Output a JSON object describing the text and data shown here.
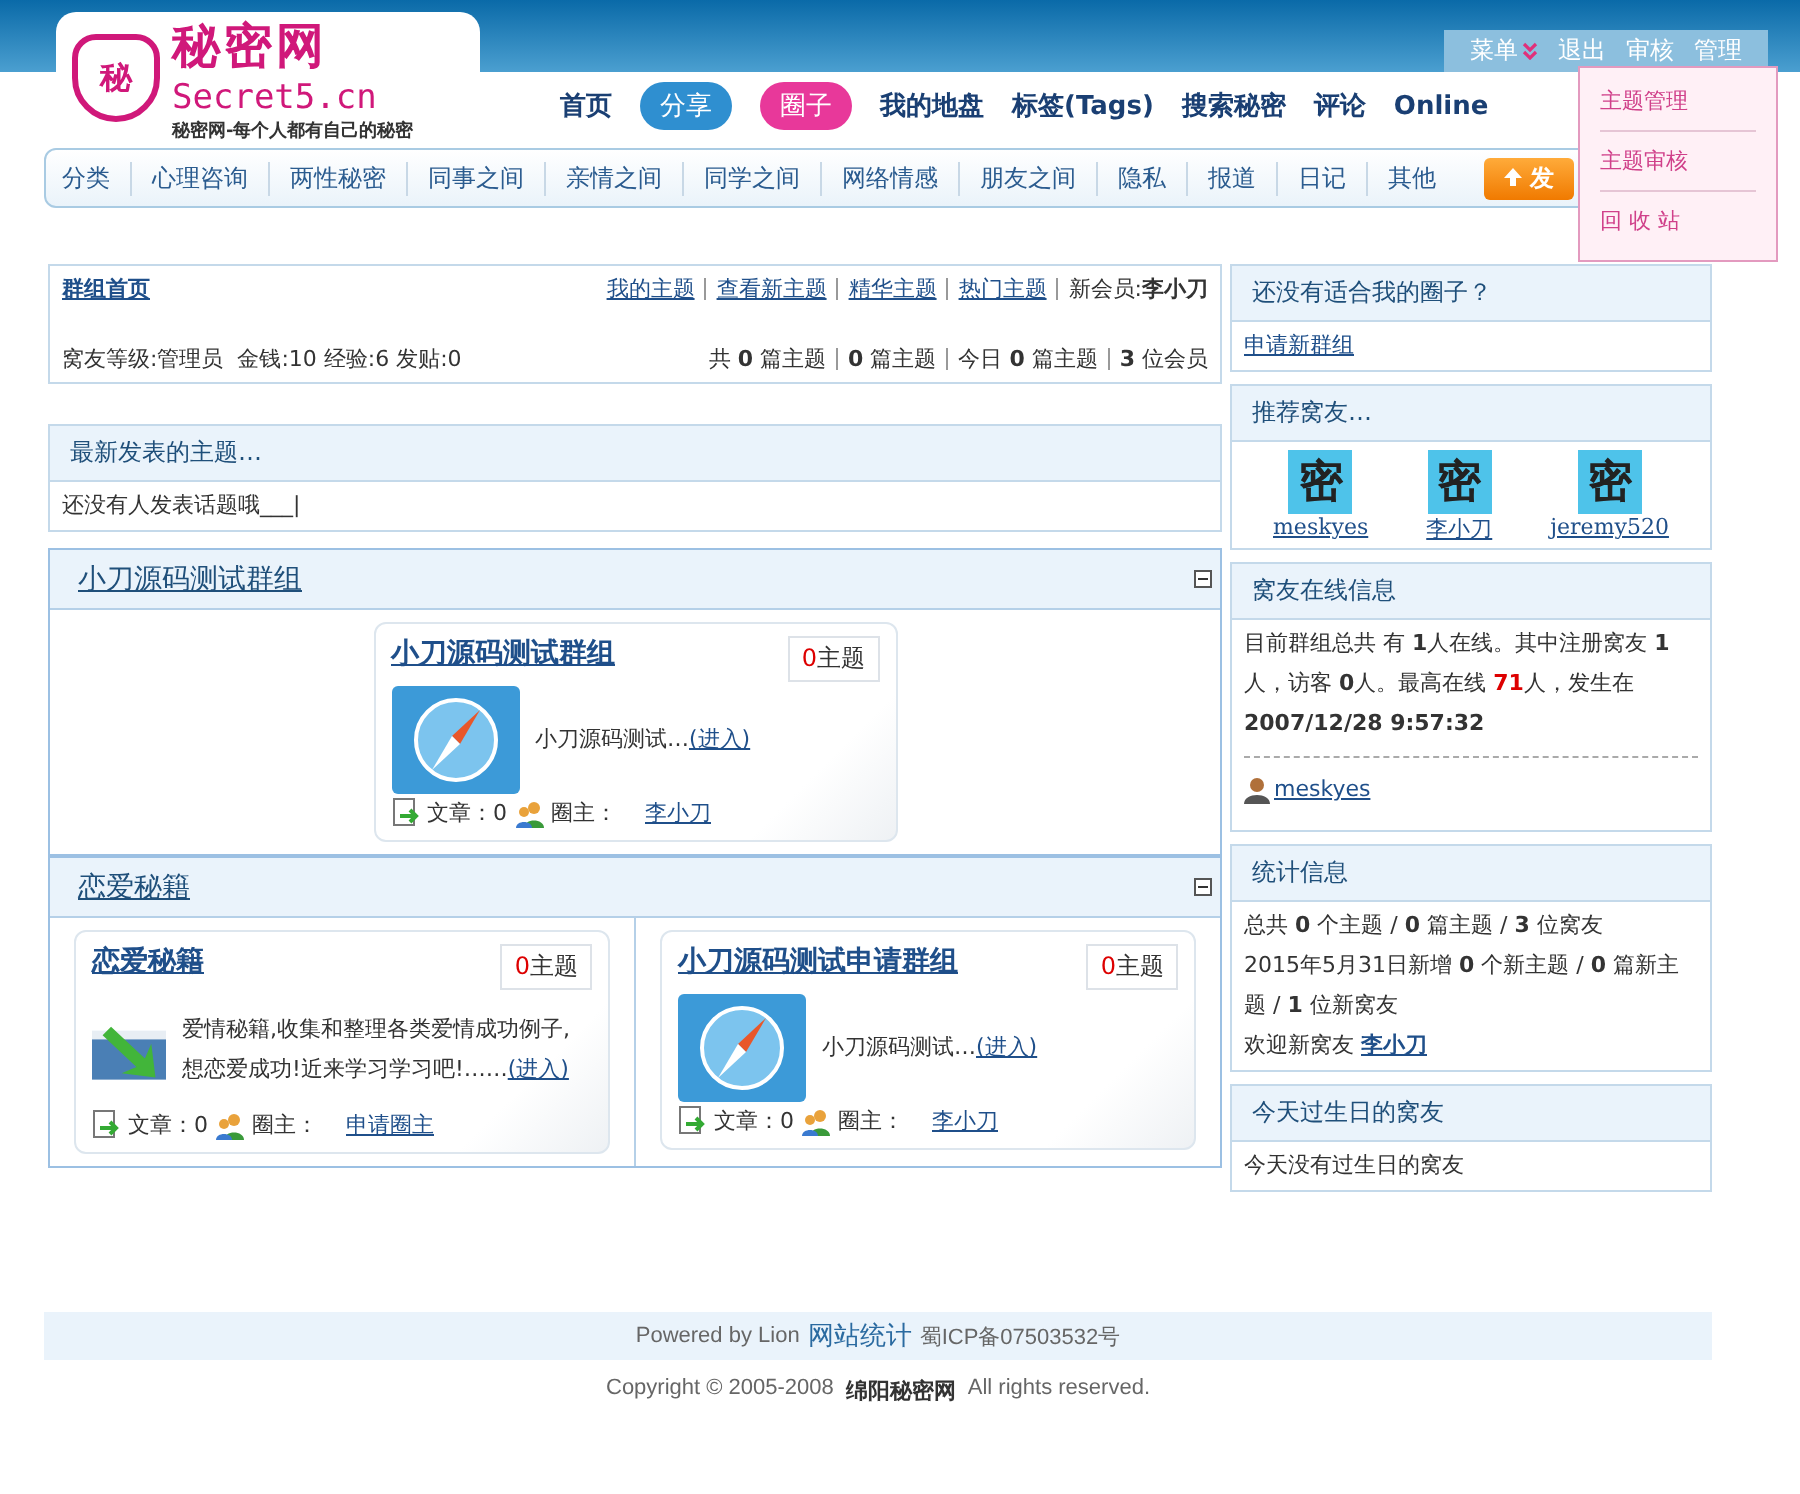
{
  "header": {
    "logo": {
      "badge": "秘",
      "name": "秘密网",
      "domain": "Secret5.cn",
      "slogan": "秘密网-每个人都有自己的秘密"
    },
    "nav": [
      {
        "label": "首页",
        "kind": "text"
      },
      {
        "label": "分享",
        "kind": "bubble",
        "color": "#2f8fd0"
      },
      {
        "label": "圈子",
        "kind": "bubble",
        "color": "#e8389a"
      },
      {
        "label": "我的地盘",
        "kind": "text"
      },
      {
        "label": "标签(Tags)",
        "kind": "text"
      },
      {
        "label": "搜索秘密",
        "kind": "text"
      },
      {
        "label": "评论",
        "kind": "text"
      },
      {
        "label": "Online",
        "kind": "text"
      }
    ],
    "user_menu": [
      {
        "label": "菜单",
        "kind": "dropdown"
      },
      {
        "label": "退出",
        "kind": "link"
      },
      {
        "label": "审核",
        "kind": "link"
      },
      {
        "label": "管理",
        "kind": "link"
      }
    ],
    "dropdown": [
      "主题管理",
      "主题审核",
      "回 收 站"
    ],
    "categories": [
      "分类",
      "心理咨询",
      "两性秘密",
      "同事之间",
      "亲情之间",
      "同学之间",
      "网络情感",
      "朋友之间",
      "隐私",
      "报道",
      "日记",
      "其他"
    ],
    "post_button": "发"
  },
  "group_home": {
    "title": "群组首页",
    "links": [
      "我的主题",
      "查看新主题",
      "精华主题",
      "热门主题"
    ],
    "new_member_label": "新会员:",
    "new_member": "李小刀",
    "user_info": "窝友等级:管理员  金钱:10 经验:6 发贴:0",
    "stats": [
      "共 **0** 篇主题",
      "**0** 篇主题",
      "今日 **0** 篇主题",
      "**3** 位会员"
    ]
  },
  "latest": {
    "title": "最新发表的主题…",
    "text": "还没有人发表话题哦___|"
  },
  "sections": [
    {
      "title": "小刀源码测试群组",
      "cards": [
        {
          "title": "小刀源码测试群组",
          "count": "0",
          "count_label": "主题",
          "kind": "compass",
          "desc": "小刀源码测试…",
          "enter": "(进入)",
          "articles_label": "文章：",
          "articles": "0",
          "owner_label": "圈主：",
          "owner": "李小刀"
        }
      ]
    },
    {
      "title": "恋爱秘籍",
      "cards": [
        {
          "title": "恋爱秘籍",
          "count": "0",
          "count_label": "主题",
          "kind": "arrow",
          "desc": "爱情秘籍,收集和整理各类爱情成功例子,想恋爱成功!近来学习学习吧!……",
          "enter": "(进入)",
          "articles_label": "文章：",
          "articles": "0",
          "owner_label": "圈主：",
          "owner": "申请圈主"
        },
        {
          "title": "小刀源码测试申请群组",
          "count": "0",
          "count_label": "主题",
          "kind": "compass",
          "desc": "小刀源码测试…",
          "enter": "(进入)",
          "articles_label": "文章：",
          "articles": "0",
          "owner_label": "圈主：",
          "owner": "李小刀"
        }
      ]
    }
  ],
  "sidebar": {
    "no_circle": {
      "title": "还没有适合我的圈子？",
      "link": "申请新群组"
    },
    "friends": {
      "title": "推荐窝友…",
      "items": [
        {
          "avatar_text": "密",
          "name": "meskyes"
        },
        {
          "avatar_text": "密",
          "name": "李小刀"
        },
        {
          "avatar_text": "密",
          "name": "jeremy520"
        }
      ]
    },
    "online": {
      "title": "窝友在线信息",
      "text_before": "目前群组总共 有 **1**人在线。其中注册窝友 **1**人，访客 **0**人。最高在线 ",
      "peak": "71",
      "text_after": "人，发生在 **2007/12/28 9:57:32**",
      "users": [
        "meskyes"
      ]
    },
    "stats": {
      "title": "统计信息",
      "lines": [
        "总共 **0** 个主题 / **0** 篇主题 / **3** 位窝友",
        "2015年5月31日新增 **0** 个新主题 / **0** 篇新主题 / **1** 位新窝友"
      ],
      "welcome_label": "欢迎新窝友",
      "welcome_name": "李小刀"
    },
    "birthday": {
      "title": "今天过生日的窝友",
      "text": "今天没有过生日的窝友"
    }
  },
  "footer": {
    "powered": "Powered by Lion",
    "stats_link": "网站统计",
    "icp": "蜀ICP备07503532号",
    "copyright": "Copyright © 2005-2008",
    "site": "绵阳秘密网",
    "rights": "All rights reserved."
  }
}
